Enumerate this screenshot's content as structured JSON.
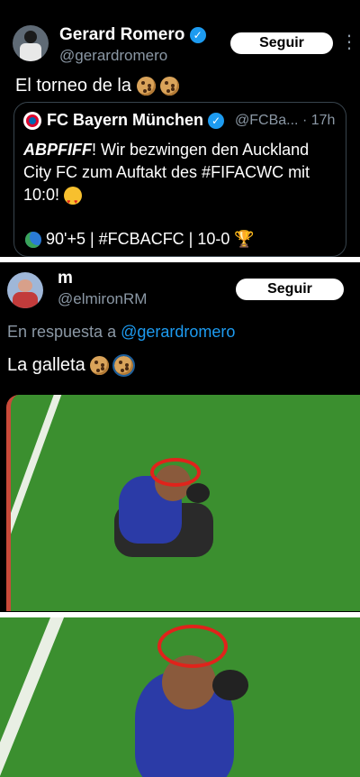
{
  "tweet1": {
    "name": "Gerard Romero",
    "handle": "@gerardromero",
    "follow_label": "Seguir",
    "more_icon": "⋮",
    "text": "El torneo de la"
  },
  "quoted": {
    "name": "FC Bayern München",
    "handle": "@FCBa...",
    "time": "· 17h",
    "line1_bold": "ABPFIFF",
    "line1_rest": "! Wir bezwingen den Auckland",
    "line2": "City FC zum Auftakt des #FIFACWC mit",
    "line3": "10:0!",
    "footer": "90'+5 | #FCBACFC | 10-0"
  },
  "tweet2": {
    "name": "m",
    "handle": "@elmironRM",
    "follow_label": "Seguir",
    "reply_prefix": "En respuesta a",
    "reply_to": "@gerardromero",
    "text": "La galleta"
  },
  "colors": {
    "link": "#1d9bf0",
    "circle": "#e0231b",
    "pitch": "#3b8f2f"
  },
  "icons": [
    "verified-badge-icon",
    "cookie-emoji-icon",
    "heart-eyes-emoji-icon",
    "globe-emoji-icon",
    "trophy-emoji-icon",
    "bayern-logo-icon",
    "more-options-icon"
  ]
}
